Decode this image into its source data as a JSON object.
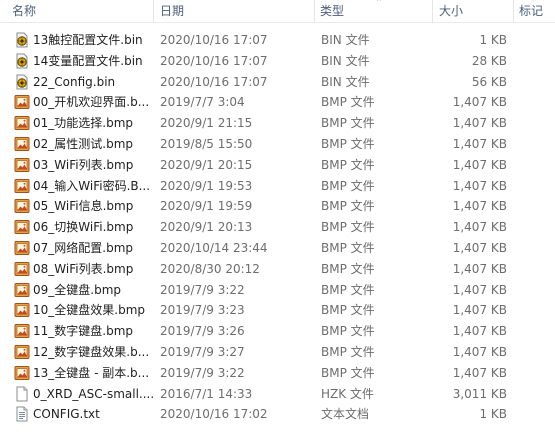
{
  "columns": {
    "name": "名称",
    "date": "日期",
    "type": "类型",
    "size": "大小",
    "tags": "标记"
  },
  "files": [
    {
      "name": "13触控配置文件.bin",
      "date": "2020/10/16 17:07",
      "type": "BIN 文件",
      "size": "1 KB",
      "icon": "bin-file-icon"
    },
    {
      "name": "14变量配置文件.bin",
      "date": "2020/10/16 17:07",
      "type": "BIN 文件",
      "size": "28 KB",
      "icon": "bin-file-icon"
    },
    {
      "name": "22_Config.bin",
      "date": "2020/10/16 17:07",
      "type": "BIN 文件",
      "size": "56 KB",
      "icon": "bin-file-icon"
    },
    {
      "name": "00_开机欢迎界面.b...",
      "date": "2019/7/7 3:04",
      "type": "BMP 文件",
      "size": "1,407 KB",
      "icon": "bmp-file-icon"
    },
    {
      "name": "01_功能选择.bmp",
      "date": "2020/9/1 21:15",
      "type": "BMP 文件",
      "size": "1,407 KB",
      "icon": "bmp-file-icon"
    },
    {
      "name": "02_属性测试.bmp",
      "date": "2019/8/5 15:50",
      "type": "BMP 文件",
      "size": "1,407 KB",
      "icon": "bmp-file-icon"
    },
    {
      "name": "03_WiFi列表.bmp",
      "date": "2020/9/1 20:15",
      "type": "BMP 文件",
      "size": "1,407 KB",
      "icon": "bmp-file-icon"
    },
    {
      "name": "04_输入WiFi密码.B...",
      "date": "2020/9/1 19:53",
      "type": "BMP 文件",
      "size": "1,407 KB",
      "icon": "bmp-file-icon"
    },
    {
      "name": "05_WiFi信息.bmp",
      "date": "2020/9/1 19:59",
      "type": "BMP 文件",
      "size": "1,407 KB",
      "icon": "bmp-file-icon"
    },
    {
      "name": "06_切换WiFi.bmp",
      "date": "2020/9/1 20:13",
      "type": "BMP 文件",
      "size": "1,407 KB",
      "icon": "bmp-file-icon"
    },
    {
      "name": "07_网络配置.bmp",
      "date": "2020/10/14 23:44",
      "type": "BMP 文件",
      "size": "1,407 KB",
      "icon": "bmp-file-icon"
    },
    {
      "name": "08_WiFi列表.bmp",
      "date": "2020/8/30 20:12",
      "type": "BMP 文件",
      "size": "1,407 KB",
      "icon": "bmp-file-icon"
    },
    {
      "name": "09_全键盘.bmp",
      "date": "2019/7/9 3:22",
      "type": "BMP 文件",
      "size": "1,407 KB",
      "icon": "bmp-file-icon"
    },
    {
      "name": "10_全键盘效果.bmp",
      "date": "2019/7/9 3:23",
      "type": "BMP 文件",
      "size": "1,407 KB",
      "icon": "bmp-file-icon"
    },
    {
      "name": "11_数字键盘.bmp",
      "date": "2019/7/9 3:26",
      "type": "BMP 文件",
      "size": "1,407 KB",
      "icon": "bmp-file-icon"
    },
    {
      "name": "12_数字键盘效果.b...",
      "date": "2019/7/9 3:27",
      "type": "BMP 文件",
      "size": "1,407 KB",
      "icon": "bmp-file-icon"
    },
    {
      "name": "13_全键盘 - 副本.b...",
      "date": "2019/7/9 3:22",
      "type": "BMP 文件",
      "size": "1,407 KB",
      "icon": "bmp-file-icon"
    },
    {
      "name": "0_XRD_ASC-small....",
      "date": "2016/7/1 14:33",
      "type": "HZK 文件",
      "size": "3,011 KB",
      "icon": "blank-file-icon"
    },
    {
      "name": "CONFIG.txt",
      "date": "2020/10/16 17:02",
      "type": "文本文档",
      "size": "1 KB",
      "icon": "text-file-icon"
    }
  ]
}
